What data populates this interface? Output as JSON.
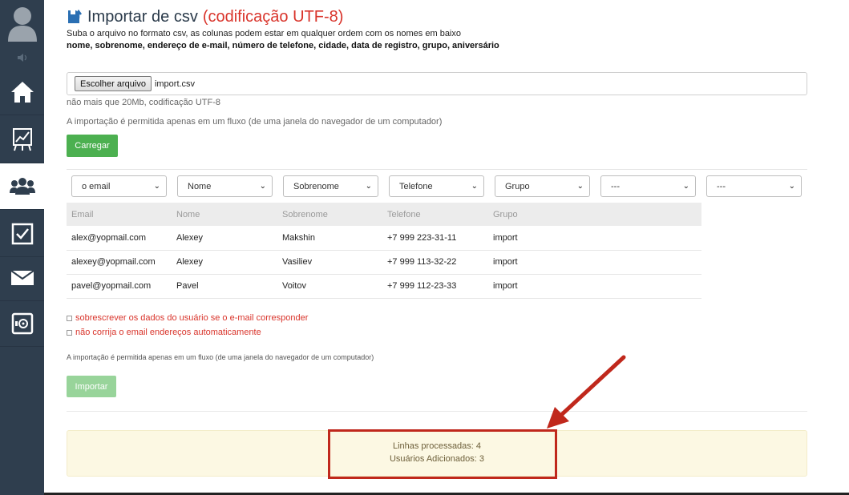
{
  "sidebar": {
    "items": [
      {
        "icon": "home-icon"
      },
      {
        "icon": "chart-icon"
      },
      {
        "icon": "users-icon",
        "active": true
      },
      {
        "icon": "checkbox-icon"
      },
      {
        "icon": "mail-icon"
      },
      {
        "icon": "safe-icon"
      }
    ]
  },
  "header": {
    "icon": "upload-file-icon",
    "title": "Importar de csv",
    "encoding": "(codificação UTF-8)",
    "subtitle": "Suba o arquivo no formato csv, as colunas podem estar em qualquer ordem com os nomes em baixo",
    "columns": "nome, sobrenome, endereço de e-mail, número de telefone, cidade, data de registro, grupo, aniversário"
  },
  "file": {
    "button_label": "Escolher arquivo",
    "file_name": "import.csv",
    "size_note": "não mais que 20Mb, codificação UTF-8",
    "flow_note": "A importação é permitida apenas em um fluxo (de uma janela do navegador de um computador)",
    "upload_label": "Carregar"
  },
  "mapping": {
    "selects": [
      "o email",
      "Nome",
      "Sobrenome",
      "Telefone",
      "Grupo",
      "---",
      "---"
    ]
  },
  "preview": {
    "headers": [
      "Email",
      "Nome",
      "Sobrenome",
      "Telefone",
      "Grupo"
    ],
    "rows": [
      [
        "alex@yopmail.com",
        "Alexey",
        "Makshin",
        "+7 999 223-31-11",
        "import"
      ],
      [
        "alexey@yopmail.com",
        "Alexey",
        "Vasiliev",
        "+7 999 113-32-22",
        "import"
      ],
      [
        "pavel@yopmail.com",
        "Pavel",
        "Voitov",
        "+7 999 112-23-33",
        "import"
      ]
    ]
  },
  "options": {
    "overwrite_label": "sobrescrever os dados do usuário se o e-mail corresponder",
    "no_fix_label": "não corrija o email endereços automaticamente",
    "flow_note": "A importação é permitida apenas em um fluxo (de uma janela do navegador de um computador)",
    "import_label": "Importar"
  },
  "result": {
    "processed": "Linhas processadas: 4",
    "added": "Usuários Adicionados: 3"
  },
  "colors": {
    "sidebar": "#2f3e4e",
    "accent_red": "#d9342b",
    "button_green": "#4cb050",
    "highlight": "#c0281c"
  }
}
